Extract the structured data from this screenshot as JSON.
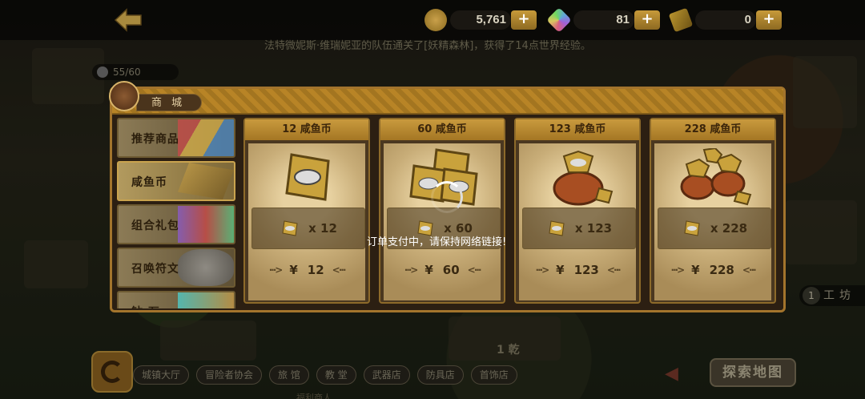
{
  "topbar": {
    "gold": {
      "value": "5,761",
      "plus": "+",
      "icon": "gold-coin-icon"
    },
    "gems": {
      "value": "81",
      "plus": "+",
      "icon": "rainbow-gem-icon"
    },
    "fish_coins": {
      "value": "0",
      "plus": "+",
      "icon": "fish-coin-icon"
    }
  },
  "announcement": "法特微妮斯·维瑞妮亚的队伍通关了[妖精森林]，获得了14点世界经验。",
  "population": "55/60",
  "shop": {
    "title": "商 城",
    "categories": [
      {
        "label": "推荐商品"
      },
      {
        "label": "咸鱼币"
      },
      {
        "label": "组合礼包"
      },
      {
        "label": "召唤符文"
      },
      {
        "label": "钻 石"
      }
    ],
    "items": [
      {
        "name": "12 咸鱼币",
        "count": "x  12",
        "currency": "¥",
        "price": "12"
      },
      {
        "name": "60 咸鱼币",
        "count": "x  60",
        "currency": "¥",
        "price": "60"
      },
      {
        "name": "123 咸鱼币",
        "count": "x  123",
        "currency": "¥",
        "price": "123"
      },
      {
        "name": "228 咸鱼币",
        "count": "x  228",
        "currency": "¥",
        "price": "228"
      }
    ]
  },
  "toast": "订单支付中，请保持网络链接!",
  "workshop": {
    "num": "1",
    "label": "工坊"
  },
  "bottom_badge": "1  乾",
  "explore": "探索地图",
  "nav": [
    "城镇大厅",
    "冒险者协会",
    "旅 馆",
    "教 堂",
    "武器店",
    "防具店",
    "首饰店"
  ],
  "bottom_text": "福利商人"
}
